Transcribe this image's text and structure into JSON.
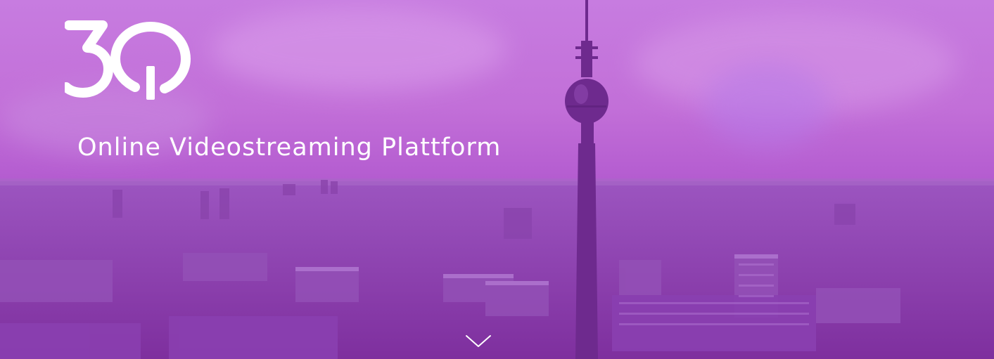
{
  "hero": {
    "logo_text": "3Q",
    "tagline": "Online Videostreaming Plattform",
    "scroll_icon": "chevron-down-icon"
  },
  "colors": {
    "overlay": "#b45cd0",
    "text": "#ffffff"
  }
}
